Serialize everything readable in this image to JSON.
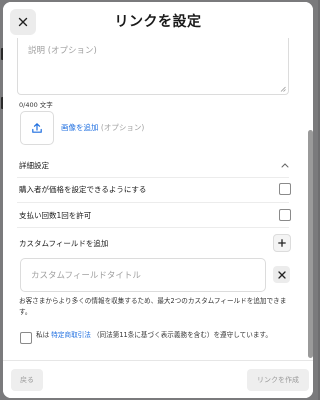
{
  "modal": {
    "title": "リンクを設定",
    "close_icon": "close-icon"
  },
  "description_field": {
    "placeholder": "説明 (オプション)",
    "char_count": "0/400 文字"
  },
  "image_upload": {
    "icon": "upload-icon",
    "link_label": "画像を追加",
    "optional_label": "(オプション)"
  },
  "advanced_section": {
    "title": "詳細設定",
    "expanded_icon": "chevron-up-icon",
    "options": [
      {
        "label": "購入者が価格を設定できるようにする",
        "checked": false
      },
      {
        "label": "支払い回数1回を許可",
        "checked": false
      }
    ]
  },
  "custom_fields": {
    "label": "カスタムフィールドを追加",
    "add_icon": "plus-icon",
    "field_placeholder": "カスタムフィールドタイトル",
    "remove_icon": "close-icon",
    "help_text": "お客さまからより多くの情報を収集するため、最大2つのカスタムフィールドを追加できます。"
  },
  "legal_notice": {
    "prefix": "私は",
    "link_label": "特定商取引法",
    "suffix": "（同法第11条に基づく表示義務を含む）を遵守しています。",
    "checked": false
  },
  "footer": {
    "back_label": "戻る",
    "create_label": "リンクを作成"
  },
  "colors": {
    "link": "#1f6fe0",
    "disabled_text": "#9a9a9a",
    "disabled_bg": "#eeeeee"
  }
}
